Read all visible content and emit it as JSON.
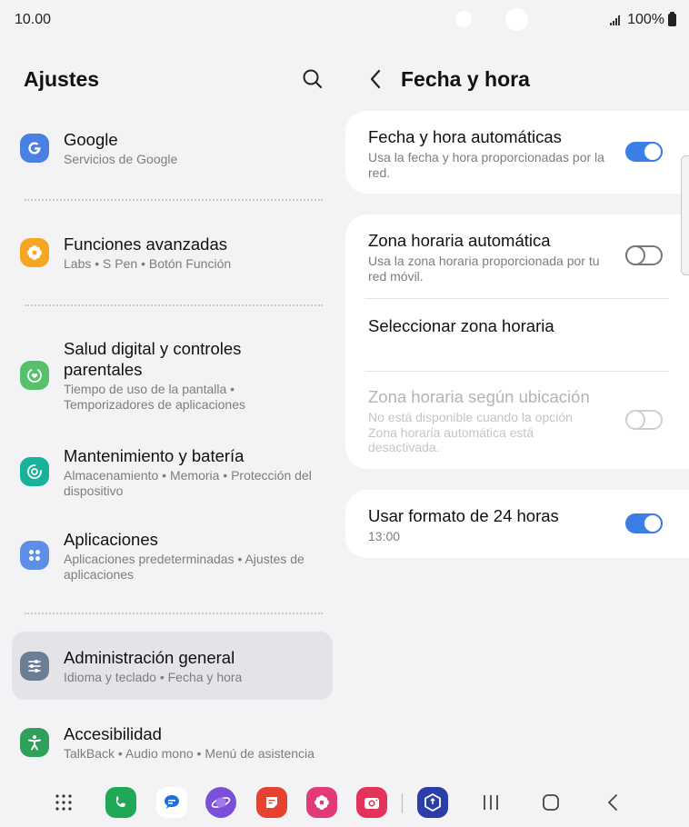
{
  "status_bar": {
    "time": "10.00",
    "battery": "100%"
  },
  "settings": {
    "title": "Ajustes",
    "items": [
      {
        "title": "Google",
        "subtitle": "Servicios de Google"
      },
      {
        "title": "Funciones avanzadas",
        "subtitle": "Labs  •  S Pen  •  Botón Función"
      },
      {
        "title": "Salud digital y controles parentales",
        "subtitle": "Tiempo de uso de la pantalla  •  Temporizadores de aplicaciones"
      },
      {
        "title": "Mantenimiento y batería",
        "subtitle": "Almacenamiento  •  Memoria  •  Protección del dispositivo"
      },
      {
        "title": "Aplicaciones",
        "subtitle": "Aplicaciones predeterminadas  •  Ajustes de aplicaciones"
      },
      {
        "title": "Administración general",
        "subtitle": "Idioma y teclado  •  Fecha y hora"
      },
      {
        "title": "Accesibilidad",
        "subtitle": "TalkBack  •  Audio mono  •  Menú de asistencia"
      }
    ]
  },
  "detail": {
    "title": "Fecha y hora",
    "auto_datetime": {
      "title": "Fecha y hora automáticas",
      "subtitle": "Usa la fecha y hora proporcionadas por la red.",
      "state": "on"
    },
    "auto_timezone": {
      "title": "Zona horaria automática",
      "subtitle": "Usa la zona horaria proporcionada por tu red móvil.",
      "state": "off"
    },
    "select_timezone": {
      "title": "Seleccionar zona horaria"
    },
    "timezone_location": {
      "title": "Zona horaria según ubicación",
      "subtitle": "No está disponible cuando la opción Zona horaria automática está desactivada.",
      "state": "disabled"
    },
    "format_24h": {
      "title": "Usar formato de 24 horas",
      "subtitle": "13:00",
      "state": "on"
    }
  },
  "colors": {
    "accent": "#3a7ee6",
    "google_icon": "#4a7fe3",
    "advanced_icon": "#f5a623",
    "wellbeing_icon": "#57c06a",
    "maintenance_icon": "#18b29a",
    "apps_icon": "#5d8ee8",
    "general_icon": "#6a7f96",
    "accessibility_icon": "#2ea05a"
  },
  "dock": [
    "apps-grid-icon",
    "phone-icon",
    "messages-icon",
    "internet-icon",
    "notes-icon",
    "gallery-icon",
    "camera-icon",
    "secure-folder-icon"
  ],
  "nav": [
    "recents-icon",
    "home-icon",
    "back-icon"
  ]
}
